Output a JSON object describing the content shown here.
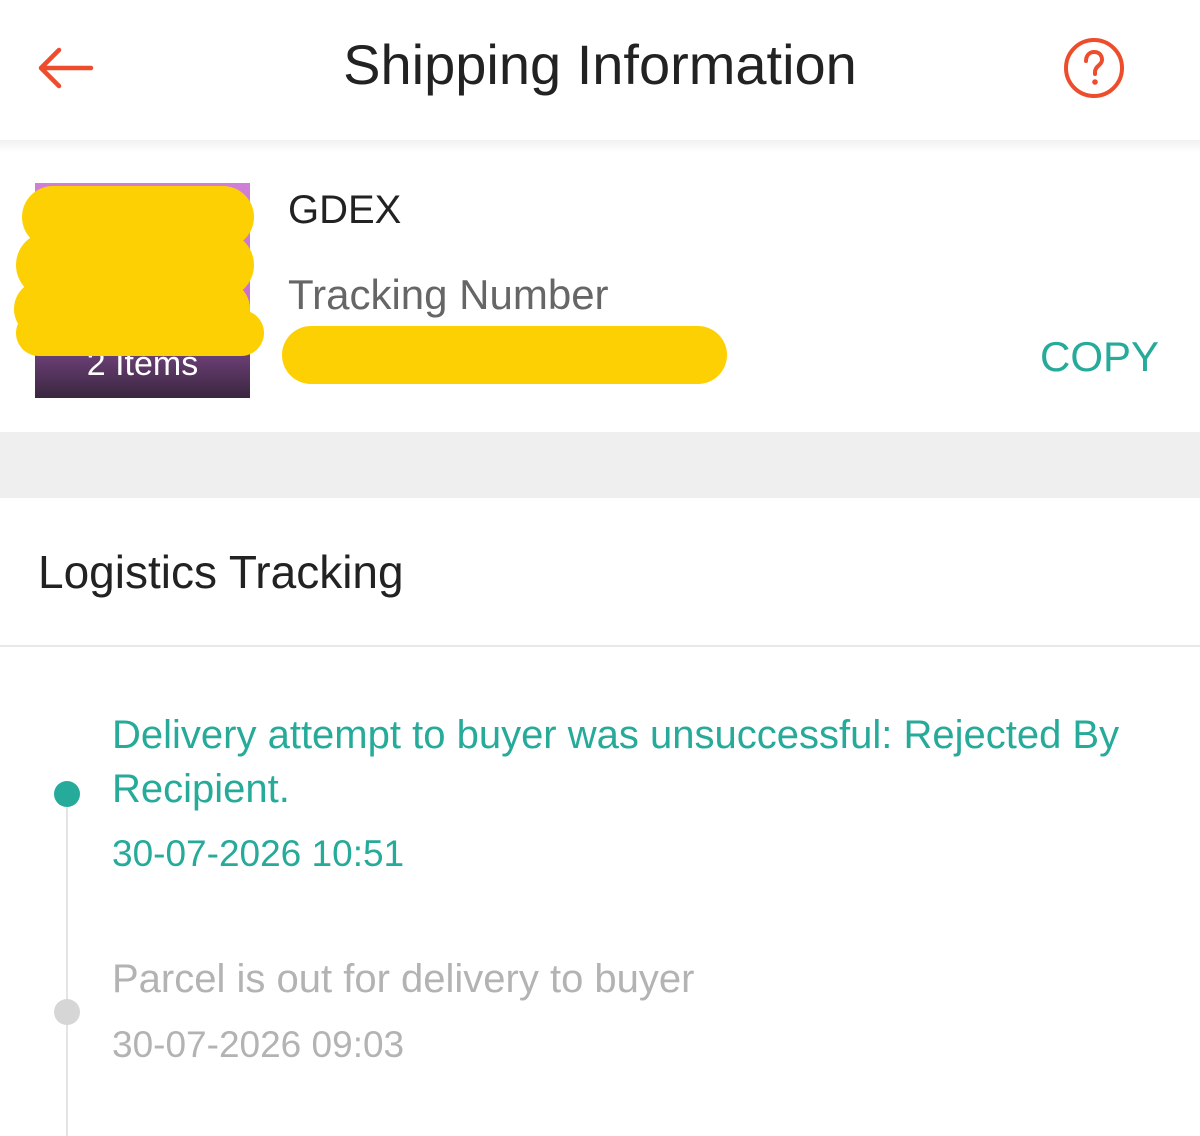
{
  "header": {
    "title": "Shipping Information",
    "back_icon": "arrow-left-icon",
    "help_icon": "question-circle-icon",
    "accent_color": "#ee4d2d"
  },
  "shipment": {
    "thumbnail_count_label": "2 Items",
    "carrier": "GDEX",
    "tracking_label": "Tracking Number",
    "copy_label": "COPY"
  },
  "logistics": {
    "title": "Logistics Tracking",
    "active_color": "#26aa99",
    "inactive_color": "#b3b3b3",
    "events": [
      {
        "description": "Delivery attempt to buyer was unsuccessful: Rejected By Recipient.",
        "time": "30-07-2026 10:51",
        "status": "current"
      },
      {
        "description": "Parcel is out for delivery to buyer",
        "time": "30-07-2026 09:03",
        "status": "past"
      }
    ]
  }
}
